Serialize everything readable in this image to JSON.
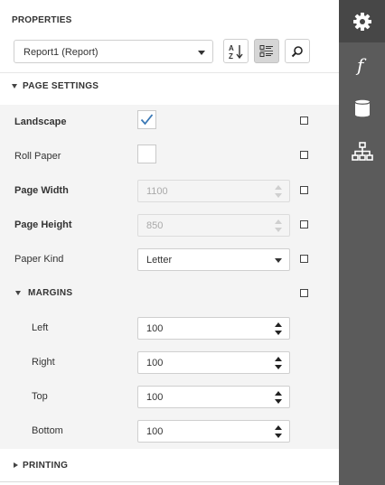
{
  "panel": {
    "title": "PROPERTIES",
    "object_selector": {
      "value": "Report1 (Report)"
    },
    "toolbar": [
      {
        "name": "sort-alphabetically-button",
        "icon": "sort-az-icon",
        "selected": false
      },
      {
        "name": "categorized-view-button",
        "icon": "categorized-icon",
        "selected": true
      },
      {
        "name": "search-button",
        "icon": "search-icon",
        "selected": false
      }
    ]
  },
  "sections": {
    "page_settings": "PAGE SETTINGS",
    "margins": "MARGINS",
    "printing": "PRINTING"
  },
  "properties": {
    "landscape": {
      "label": "Landscape",
      "checked": true
    },
    "roll_paper": {
      "label": "Roll Paper",
      "checked": false
    },
    "page_width": {
      "label": "Page Width",
      "value": "1100"
    },
    "page_height": {
      "label": "Page Height",
      "value": "850"
    },
    "paper_kind": {
      "label": "Paper Kind",
      "value": "Letter"
    }
  },
  "margins": {
    "left": {
      "label": "Left",
      "value": "100"
    },
    "right": {
      "label": "Right",
      "value": "100"
    },
    "top": {
      "label": "Top",
      "value": "100"
    },
    "bottom": {
      "label": "Bottom",
      "value": "100"
    }
  },
  "rail": [
    {
      "name": "properties-tab",
      "icon": "gear-icon",
      "active": true
    },
    {
      "name": "expressions-tab",
      "icon": "function-icon",
      "active": false
    },
    {
      "name": "data-source-tab",
      "icon": "database-icon",
      "active": false
    },
    {
      "name": "report-explorer-tab",
      "icon": "hierarchy-icon",
      "active": false
    }
  ],
  "colors": {
    "accent": "#3a78b5",
    "rail_bg": "#5b5b5b",
    "rail_active": "#474747",
    "group_bg": "#f4f4f4"
  }
}
